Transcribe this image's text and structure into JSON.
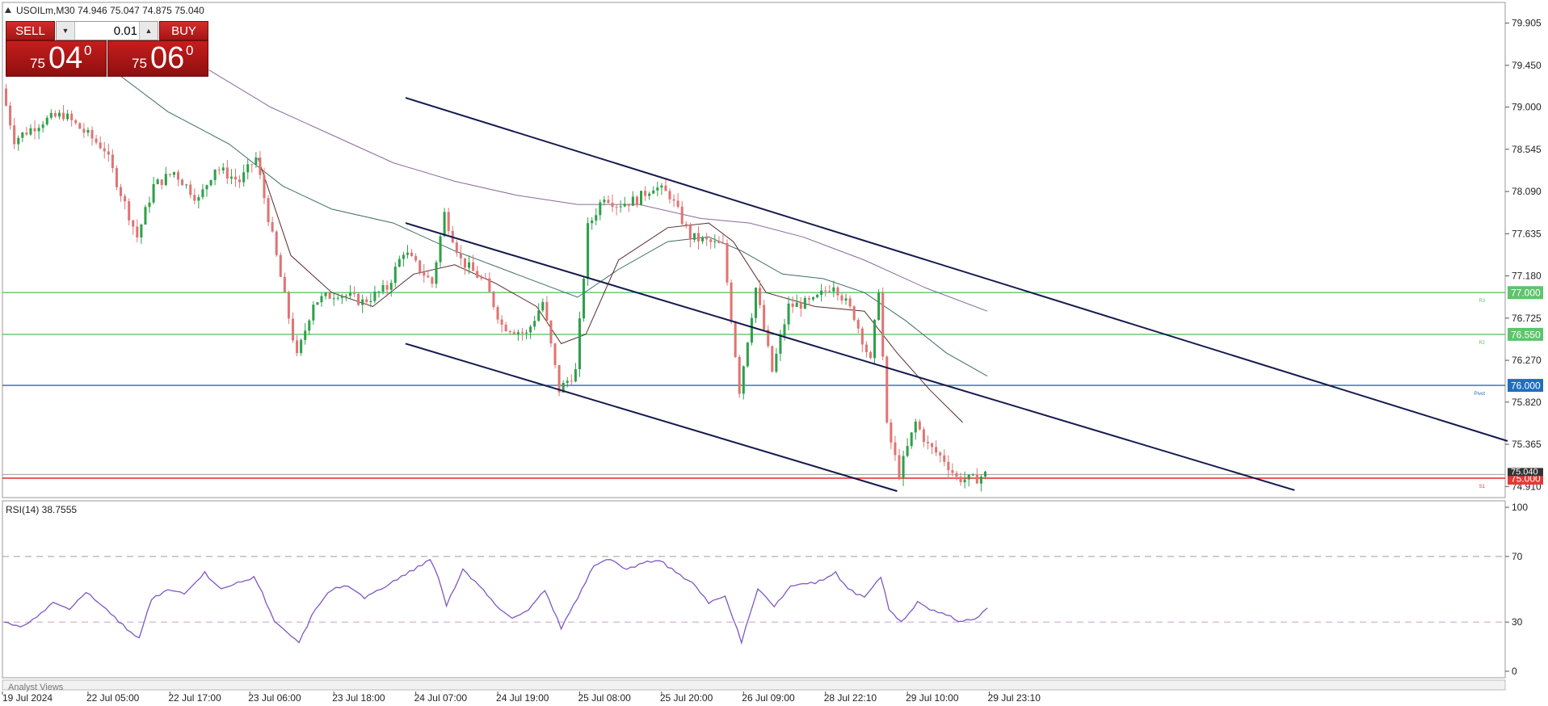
{
  "header": {
    "symbol_info": "USOILm,M30  74.946 75.047 74.875 75.040"
  },
  "trade_panel": {
    "sell_label": "SELL",
    "buy_label": "BUY",
    "lot_value": "0.01",
    "sell_price": {
      "small": "75",
      "big": "04",
      "sup": "0"
    },
    "buy_price": {
      "small": "75",
      "big": "06",
      "sup": "0"
    }
  },
  "colors": {
    "bull": "#2ea04a",
    "bear": "#e07474",
    "channel": "#141a4e",
    "resistance": "#5fc46b",
    "pivot": "#1f6fbf",
    "bid": "#e53935",
    "rsi": "#7e57c2",
    "ma_fast": "#5a2a2a",
    "ma_mid": "#3e6b6b",
    "ma_slow": "#8a6a9a"
  },
  "chart_data": [
    {
      "type": "candlestick",
      "title": "USOILm,M30",
      "price_ticks": [
        "79.905",
        "79.450",
        "79.000",
        "78.545",
        "78.090",
        "77.635",
        "77.180",
        "76.725",
        "76.270",
        "75.820",
        "75.365",
        "74.910"
      ],
      "ylim": [
        74.86,
        79.98
      ],
      "time_ticks": [
        "19 Jul 2024",
        "22 Jul 05:00",
        "22 Jul 17:00",
        "23 Jul 06:00",
        "23 Jul 18:00",
        "24 Jul 07:00",
        "24 Jul 19:00",
        "25 Jul 08:00",
        "25 Jul 20:00",
        "26 Jul 09:00",
        "28 Jul 22:10",
        "29 Jul 10:00",
        "29 Jul 23:10"
      ],
      "bar_count": 240,
      "close_path": [
        [
          0,
          79.2
        ],
        [
          3,
          78.65
        ],
        [
          10,
          78.85
        ],
        [
          15,
          78.92
        ],
        [
          25,
          78.55
        ],
        [
          33,
          77.6
        ],
        [
          37,
          78.15
        ],
        [
          42,
          78.3
        ],
        [
          48,
          78.0
        ],
        [
          52,
          78.35
        ],
        [
          58,
          78.2
        ],
        [
          62,
          78.45
        ],
        [
          66,
          77.6
        ],
        [
          72,
          76.3
        ],
        [
          76,
          76.9
        ],
        [
          82,
          77.0
        ],
        [
          88,
          76.9
        ],
        [
          94,
          77.05
        ],
        [
          98,
          77.45
        ],
        [
          105,
          77.1
        ],
        [
          108,
          77.85
        ],
        [
          112,
          77.35
        ],
        [
          118,
          77.1
        ],
        [
          122,
          76.65
        ],
        [
          128,
          76.55
        ],
        [
          132,
          76.9
        ],
        [
          136,
          75.95
        ],
        [
          140,
          76.15
        ],
        [
          143,
          77.7
        ],
        [
          147,
          78.05
        ],
        [
          150,
          77.95
        ],
        [
          155,
          78.0
        ],
        [
          159,
          78.15
        ],
        [
          163,
          78.05
        ],
        [
          168,
          77.6
        ],
        [
          176,
          77.5
        ],
        [
          180,
          75.95
        ],
        [
          184,
          77.05
        ],
        [
          188,
          76.15
        ],
        [
          192,
          76.85
        ],
        [
          198,
          76.9
        ],
        [
          203,
          77.1
        ],
        [
          208,
          76.75
        ],
        [
          212,
          76.25
        ],
        [
          214,
          77.05
        ],
        [
          216,
          75.55
        ],
        [
          219,
          75.05
        ],
        [
          223,
          75.6
        ],
        [
          226,
          75.35
        ],
        [
          230,
          75.2
        ],
        [
          233,
          75.0
        ],
        [
          237,
          74.98
        ],
        [
          240,
          75.04
        ]
      ],
      "moving_averages": {
        "fast": [
          [
            62,
            78.45
          ],
          [
            70,
            77.4
          ],
          [
            80,
            77.0
          ],
          [
            90,
            76.85
          ],
          [
            100,
            77.2
          ],
          [
            110,
            77.3
          ],
          [
            120,
            77.1
          ],
          [
            130,
            76.85
          ],
          [
            136,
            76.45
          ],
          [
            142,
            76.55
          ],
          [
            150,
            77.35
          ],
          [
            162,
            77.7
          ],
          [
            172,
            77.75
          ],
          [
            178,
            77.55
          ],
          [
            186,
            77.0
          ],
          [
            198,
            76.85
          ],
          [
            210,
            76.8
          ],
          [
            218,
            76.35
          ],
          [
            226,
            75.95
          ],
          [
            234,
            75.6
          ]
        ],
        "mid": [
          [
            28,
            79.35
          ],
          [
            40,
            78.95
          ],
          [
            55,
            78.6
          ],
          [
            68,
            78.15
          ],
          [
            80,
            77.9
          ],
          [
            95,
            77.75
          ],
          [
            110,
            77.45
          ],
          [
            125,
            77.2
          ],
          [
            140,
            76.95
          ],
          [
            150,
            77.25
          ],
          [
            162,
            77.55
          ],
          [
            172,
            77.6
          ],
          [
            180,
            77.45
          ],
          [
            190,
            77.2
          ],
          [
            200,
            77.15
          ],
          [
            210,
            77.0
          ],
          [
            220,
            76.7
          ],
          [
            230,
            76.35
          ],
          [
            240,
            76.1
          ]
        ],
        "slow": [
          [
            50,
            79.4
          ],
          [
            65,
            79.0
          ],
          [
            80,
            78.7
          ],
          [
            95,
            78.4
          ],
          [
            110,
            78.2
          ],
          [
            125,
            78.05
          ],
          [
            140,
            77.95
          ],
          [
            155,
            77.95
          ],
          [
            170,
            77.8
          ],
          [
            182,
            77.75
          ],
          [
            195,
            77.6
          ],
          [
            210,
            77.35
          ],
          [
            225,
            77.05
          ],
          [
            240,
            76.8
          ]
        ]
      },
      "channel_lines": [
        {
          "from": [
            98,
            79.1
          ],
          "to": [
            367,
            75.4
          ]
        },
        {
          "from": [
            98,
            77.75
          ],
          "to": [
            315,
            74.87
          ]
        },
        {
          "from": [
            98,
            76.45
          ],
          "to": [
            218,
            74.86
          ]
        }
      ],
      "horizontal_levels": [
        {
          "value": 77.0,
          "label": "77.000",
          "tag": "R3",
          "color": "resistance"
        },
        {
          "value": 76.55,
          "label": "76.550",
          "tag": "R2",
          "color": "resistance"
        },
        {
          "value": 76.0,
          "label": "76.000",
          "tag": "Pivot",
          "color": "pivot"
        },
        {
          "value": 75.0,
          "label": "75.000",
          "tag": "S1",
          "color": "bid"
        }
      ],
      "current_price_label": "75.040"
    },
    {
      "type": "line",
      "title": "RSI(14) 38.7555",
      "ylim": [
        0,
        100
      ],
      "ticks": [
        "100",
        "70",
        "30",
        "0"
      ],
      "levels": [
        70,
        30
      ],
      "series": [
        {
          "name": "RSI(14)",
          "points": [
            [
              0,
              30
            ],
            [
              4,
              27
            ],
            [
              8,
              33
            ],
            [
              12,
              42
            ],
            [
              16,
              38
            ],
            [
              20,
              48
            ],
            [
              24,
              40
            ],
            [
              28,
              30
            ],
            [
              33,
              20
            ],
            [
              36,
              44
            ],
            [
              40,
              50
            ],
            [
              44,
              47
            ],
            [
              49,
              60
            ],
            [
              53,
              50
            ],
            [
              57,
              54
            ],
            [
              61,
              57
            ],
            [
              63,
              48
            ],
            [
              66,
              30
            ],
            [
              72,
              18
            ],
            [
              76,
              38
            ],
            [
              80,
              50
            ],
            [
              84,
              52
            ],
            [
              88,
              45
            ],
            [
              92,
              50
            ],
            [
              96,
              56
            ],
            [
              100,
              62
            ],
            [
              104,
              68
            ],
            [
              106,
              58
            ],
            [
              108,
              40
            ],
            [
              112,
              62
            ],
            [
              116,
              52
            ],
            [
              120,
              40
            ],
            [
              124,
              32
            ],
            [
              128,
              38
            ],
            [
              132,
              50
            ],
            [
              136,
              26
            ],
            [
              140,
              45
            ],
            [
              144,
              65
            ],
            [
              148,
              68
            ],
            [
              152,
              62
            ],
            [
              156,
              66
            ],
            [
              160,
              68
            ],
            [
              164,
              60
            ],
            [
              168,
              54
            ],
            [
              172,
              42
            ],
            [
              176,
              46
            ],
            [
              180,
              18
            ],
            [
              184,
              50
            ],
            [
              188,
              40
            ],
            [
              192,
              52
            ],
            [
              198,
              54
            ],
            [
              203,
              60
            ],
            [
              206,
              50
            ],
            [
              210,
              45
            ],
            [
              214,
              58
            ],
            [
              216,
              38
            ],
            [
              219,
              30
            ],
            [
              223,
              42
            ],
            [
              226,
              38
            ],
            [
              230,
              35
            ],
            [
              233,
              30
            ],
            [
              237,
              32
            ],
            [
              240,
              38.8
            ]
          ]
        }
      ]
    }
  ],
  "bottom_tab_label": "Analyst Views"
}
